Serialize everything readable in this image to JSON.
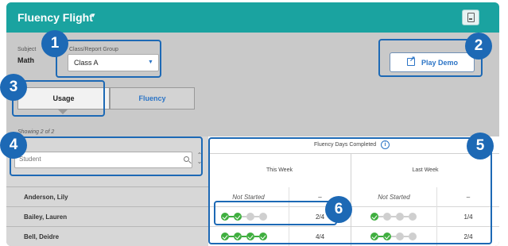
{
  "header": {
    "title": "Fluency Flight",
    "title_caret": "▾",
    "pdf_icon": "pdf-icon"
  },
  "filters": {
    "subject_label": "Subject",
    "subject_value": "Math",
    "group_label": "Class/Report Group",
    "group_value": "Class A"
  },
  "play_demo": {
    "label": "Play Demo",
    "icon": "external-link-icon"
  },
  "tabs": [
    {
      "label": "Usage",
      "selected": true
    },
    {
      "label": "Fluency",
      "selected": false
    }
  ],
  "showing_text": "Showing 2 of 2",
  "table": {
    "search_placeholder": "Student",
    "heading": "Fluency Days Completed",
    "weeks": [
      "This Week",
      "Last Week"
    ],
    "rows": [
      {
        "name": "Anderson, Lily",
        "this_week": {
          "status": "Not Started",
          "completed": 0,
          "total": 4,
          "score": "–"
        },
        "last_week": {
          "status": "Not Started",
          "completed": 0,
          "total": 4,
          "score": "–"
        }
      },
      {
        "name": "Bailey, Lauren",
        "this_week": {
          "status": "",
          "completed": 2,
          "total": 4,
          "score": "2/4"
        },
        "last_week": {
          "status": "",
          "completed": 1,
          "total": 4,
          "score": "1/4"
        }
      },
      {
        "name": "Bell, Deidre",
        "this_week": {
          "status": "",
          "completed": 4,
          "total": 4,
          "score": "4/4"
        },
        "last_week": {
          "status": "",
          "completed": 2,
          "total": 4,
          "score": "2/4"
        }
      }
    ]
  },
  "callouts": [
    "1",
    "2",
    "3",
    "4",
    "5",
    "6"
  ],
  "colors": {
    "header": "#1aa3a0",
    "accent": "#2b74c6",
    "callout": "#1d69b5",
    "complete": "#3fae3f",
    "incomplete": "#cfcfcf"
  }
}
